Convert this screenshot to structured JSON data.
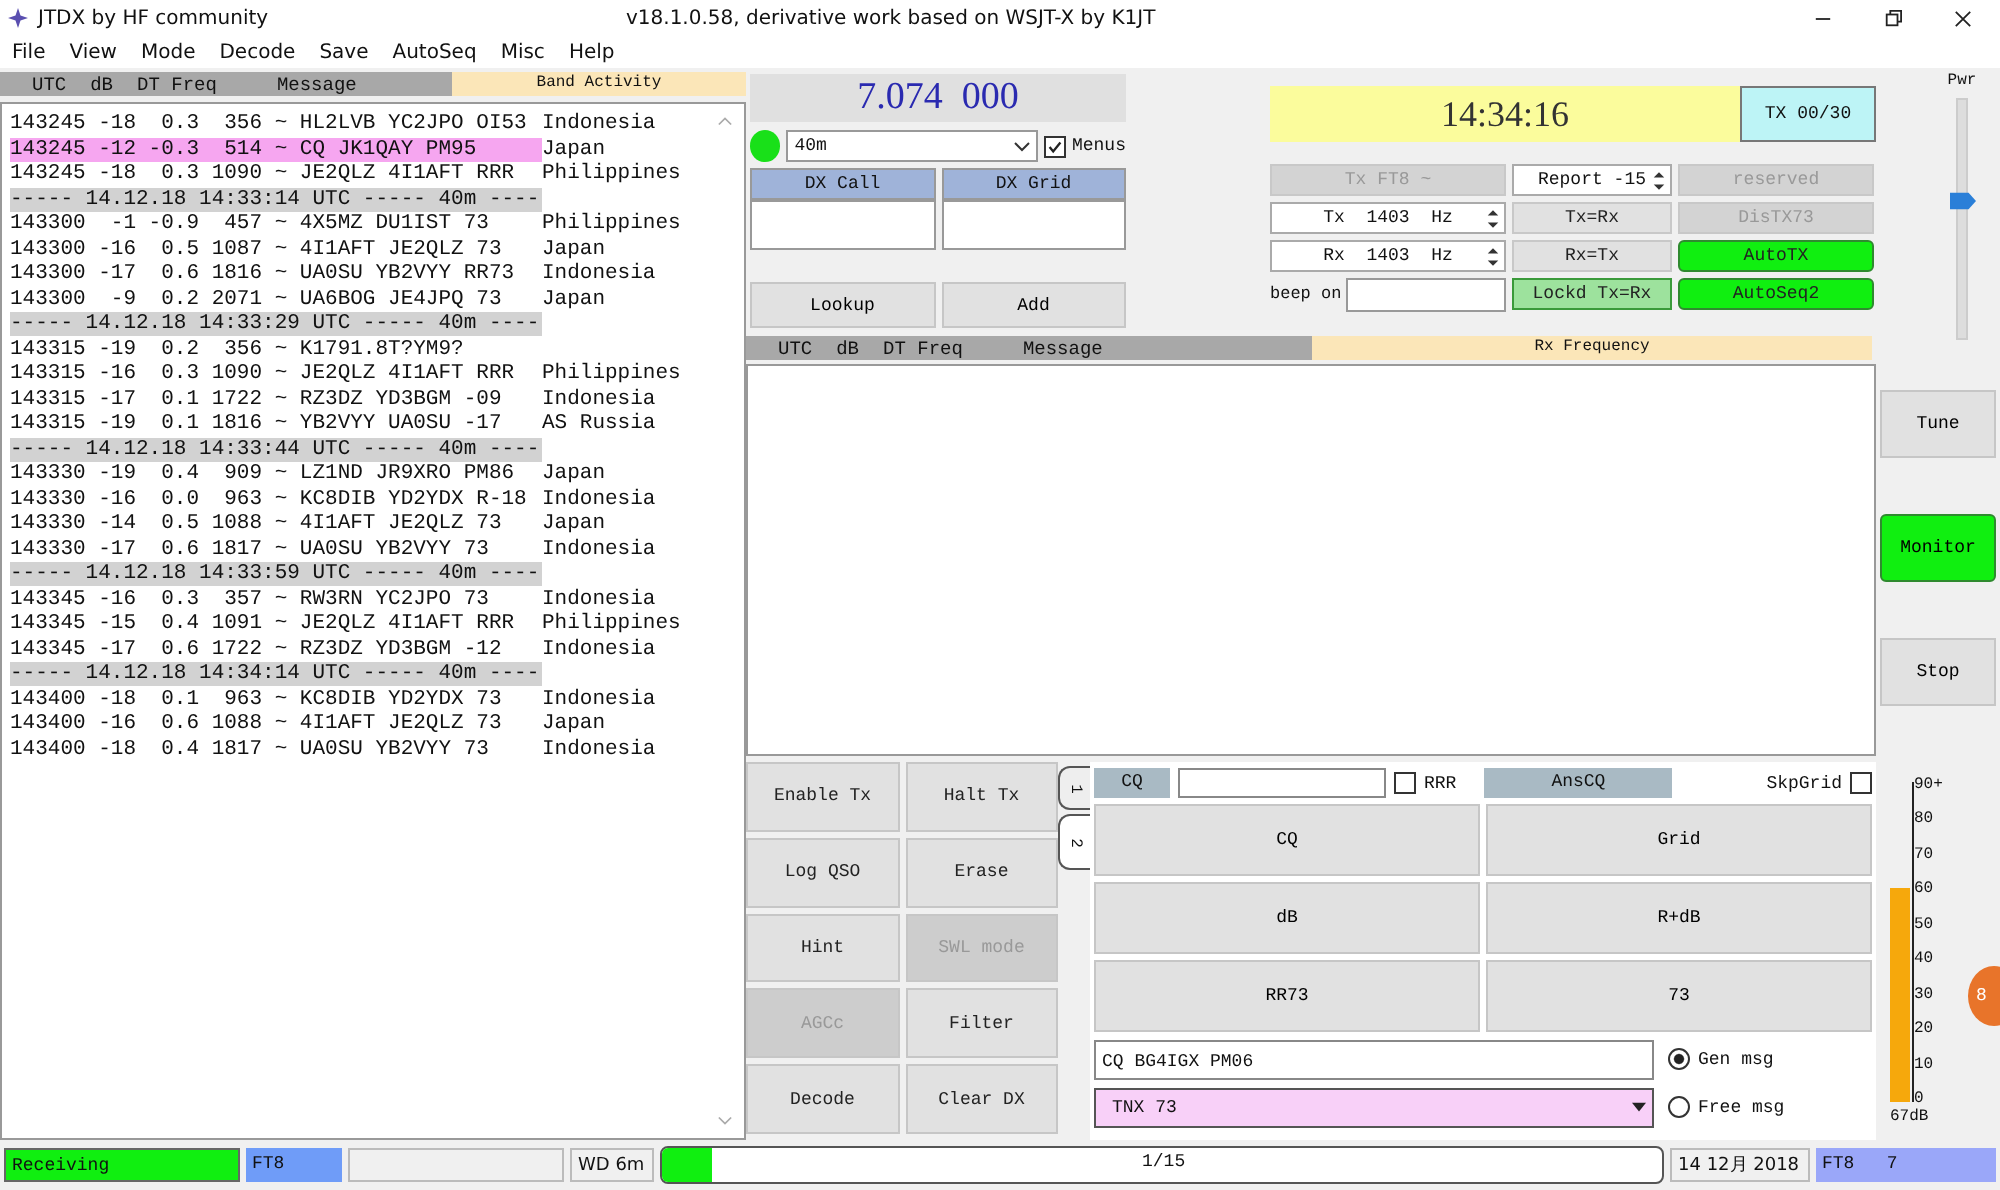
{
  "window": {
    "title": "JTDX  by HF community",
    "subtitle": "v18.1.0.58, derivative work based on WSJT-X by K1JT"
  },
  "menu": [
    "File",
    "View",
    "Mode",
    "Decode",
    "Save",
    "AutoSeq",
    "Misc",
    "Help"
  ],
  "band_activity": {
    "columns": [
      "UTC",
      "dB",
      "DT Freq",
      "Message"
    ],
    "title": "Band Activity",
    "lines": [
      {
        "kind": "decode",
        "text": "143245 -18  0.3  356 ~ HL2LVB YC2JPO OI53",
        "country": "Indonesia",
        "highlighted": false
      },
      {
        "kind": "decode",
        "text": "143245 -12 -0.3  514 ~ CQ JK1QAY PM95",
        "country": "Japan",
        "highlighted": true
      },
      {
        "kind": "decode",
        "text": "143245 -18  0.3 1090 ~ JE2QLZ 4I1AFT RRR",
        "country": "Philippines",
        "highlighted": false
      },
      {
        "kind": "separator",
        "text": "----- 14.12.18 14:33:14 UTC ----- 40m ----"
      },
      {
        "kind": "decode",
        "text": "143300  -1 -0.9  457 ~ 4X5MZ DU1IST 73",
        "country": "Philippines",
        "highlighted": false
      },
      {
        "kind": "decode",
        "text": "143300 -16  0.5 1087 ~ 4I1AFT JE2QLZ 73",
        "country": "Japan",
        "highlighted": false
      },
      {
        "kind": "decode",
        "text": "143300 -17  0.6 1816 ~ UA0SU YB2VYY RR73",
        "country": "Indonesia",
        "highlighted": false
      },
      {
        "kind": "decode",
        "text": "143300  -9  0.2 2071 ~ UA6BOG JE4JPQ 73",
        "country": "Japan",
        "highlighted": false
      },
      {
        "kind": "separator",
        "text": "----- 14.12.18 14:33:29 UTC ----- 40m ----"
      },
      {
        "kind": "decode",
        "text": "143315 -19  0.2  356 ~ K1791.8T?YM9?",
        "highlighted": false
      },
      {
        "kind": "decode",
        "text": "143315 -16  0.3 1090 ~ JE2QLZ 4I1AFT RRR",
        "country": "Philippines",
        "highlighted": false
      },
      {
        "kind": "decode",
        "text": "143315 -17  0.1 1722 ~ RZ3DZ YD3BGM -09",
        "country": "Indonesia",
        "highlighted": false
      },
      {
        "kind": "decode",
        "text": "143315 -19  0.1 1816 ~ YB2VYY UA0SU -17",
        "country": "AS Russia",
        "highlighted": false
      },
      {
        "kind": "separator",
        "text": "----- 14.12.18 14:33:44 UTC ----- 40m ----"
      },
      {
        "kind": "decode",
        "text": "143330 -19  0.4  909 ~ LZ1ND JR9XRO PM86",
        "country": "Japan",
        "highlighted": false
      },
      {
        "kind": "decode",
        "text": "143330 -16  0.0  963 ~ KC8DIB YD2YDX R-18",
        "country": "Indonesia",
        "highlighted": false
      },
      {
        "kind": "decode",
        "text": "143330 -14  0.5 1088 ~ 4I1AFT JE2QLZ 73",
        "country": "Japan",
        "highlighted": false
      },
      {
        "kind": "decode",
        "text": "143330 -17  0.6 1817 ~ UA0SU YB2VYY 73",
        "country": "Indonesia",
        "highlighted": false
      },
      {
        "kind": "separator",
        "text": "----- 14.12.18 14:33:59 UTC ----- 40m ----"
      },
      {
        "kind": "decode",
        "text": "143345 -16  0.3  357 ~ RW3RN YC2JPO 73",
        "country": "Indonesia",
        "highlighted": false
      },
      {
        "kind": "decode",
        "text": "143345 -15  0.4 1091 ~ JE2QLZ 4I1AFT RRR",
        "country": "Philippines",
        "highlighted": false
      },
      {
        "kind": "decode",
        "text": "143345 -17  0.6 1722 ~ RZ3DZ YD3BGM -12",
        "country": "Indonesia",
        "highlighted": false
      },
      {
        "kind": "separator",
        "text": "----- 14.12.18 14:34:14 UTC ----- 40m ----"
      },
      {
        "kind": "decode",
        "text": "143400 -18  0.1  963 ~ KC8DIB YD2YDX 73",
        "country": "Indonesia",
        "highlighted": false
      },
      {
        "kind": "decode",
        "text": "143400 -16  0.6 1088 ~ 4I1AFT JE2QLZ 73",
        "country": "Japan",
        "highlighted": false
      },
      {
        "kind": "decode",
        "text": "143400 -18  0.4 1817 ~ UA0SU YB2VYY 73",
        "country": "Indonesia",
        "highlighted": false
      }
    ]
  },
  "frequency": "7.074  000",
  "band": "40m",
  "menus_checkbox": {
    "label": "Menus",
    "checked": true
  },
  "dx_call": {
    "label": "DX Call"
  },
  "dx_grid": {
    "label": "DX Grid"
  },
  "lookup_buttons": [
    "Lookup",
    "Add"
  ],
  "clock": "14:34:16",
  "tx_counter": "TX 00/30",
  "controls": [
    {
      "kind": "button",
      "label": "Tx FT8 ~",
      "disabled": true,
      "on": false
    },
    {
      "kind": "spin",
      "label": "Report -15"
    },
    {
      "kind": "button",
      "label": "reserved",
      "disabled": true,
      "on": false
    },
    {
      "kind": "spin",
      "label": "Tx  1403  Hz"
    },
    {
      "kind": "button",
      "label": "Tx=Rx",
      "disabled": false,
      "on": false
    },
    {
      "kind": "button",
      "label": "DisTX73",
      "disabled": true,
      "on": false
    },
    {
      "kind": "spin",
      "label": "Rx  1403  Hz"
    },
    {
      "kind": "button",
      "label": "Rx=Tx",
      "disabled": false,
      "on": false
    },
    {
      "kind": "button",
      "label": "AutoTX",
      "disabled": false,
      "on": true
    },
    {
      "kind": "field",
      "label": "beep on"
    },
    {
      "kind": "toggle",
      "label": "Lockd Tx=Rx",
      "checked": true
    },
    {
      "kind": "button",
      "label": "AutoSeq2",
      "disabled": false,
      "on": true
    }
  ],
  "power": {
    "label": "Pwr",
    "level": 0.58
  },
  "rx_frequency": {
    "columns": [
      "UTC",
      "dB",
      "DT Freq",
      "Message"
    ],
    "title": "Rx Frequency"
  },
  "side_buttons": [
    {
      "label": "Tune",
      "on": false
    },
    {
      "label": "Monitor",
      "on": true
    },
    {
      "label": "Stop",
      "on": false
    }
  ],
  "action_buttons": [
    {
      "label": "Enable Tx",
      "disabled": false
    },
    {
      "label": "Halt Tx",
      "disabled": false
    },
    {
      "label": "Log QSO",
      "disabled": false
    },
    {
      "label": "Erase",
      "disabled": false
    },
    {
      "label": "Hint",
      "disabled": false
    },
    {
      "label": "SWL mode",
      "disabled": true
    },
    {
      "label": "AGCc",
      "disabled": true
    },
    {
      "label": "Filter",
      "disabled": false
    },
    {
      "label": "Decode",
      "disabled": false
    },
    {
      "label": "Clear DX",
      "disabled": false
    }
  ],
  "tabs": [
    {
      "label": "1",
      "selected": false
    },
    {
      "label": "2",
      "selected": true
    }
  ],
  "message_row": {
    "cq_label": "CQ",
    "rrr": {
      "label": "RRR",
      "checked": false
    },
    "ans_cq": "AnsCQ",
    "skip_grid": {
      "label": "SkpGrid",
      "checked": false
    }
  },
  "message_buttons": [
    "CQ",
    "Grid",
    "dB",
    "R+dB",
    "RR73",
    "73"
  ],
  "gen_msg": {
    "value": "CQ BG4IGX PM06",
    "label": "Gen msg",
    "selected": true
  },
  "free_msg": {
    "value": "TNX 73",
    "label": "Free msg",
    "selected": false
  },
  "meter": {
    "ticks": [
      "90+",
      "80",
      "70",
      "60",
      "50",
      "40",
      "30",
      "20",
      "10",
      "0"
    ],
    "level": 0.67,
    "reading": "67dB"
  },
  "badge": "8",
  "status_bar": {
    "state": "Receiving",
    "mode": "FT8",
    "watchdog": "WD 6m",
    "progress": {
      "level": 0.05,
      "label": "1/15"
    },
    "date": "14 12月 2018",
    "mode_count": "FT8   7"
  }
}
